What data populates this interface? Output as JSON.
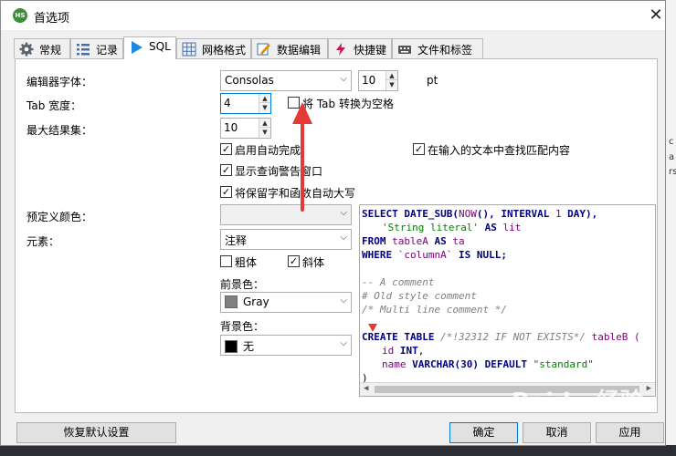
{
  "window": {
    "title": "首选项",
    "app_icon_text": "HS"
  },
  "tabs": [
    {
      "label": "常规",
      "icon": "gear-icon"
    },
    {
      "label": "记录",
      "icon": "list-icon"
    },
    {
      "label": "SQL",
      "icon": "play-icon"
    },
    {
      "label": "网格格式",
      "icon": "grid-icon"
    },
    {
      "label": "数据编辑",
      "icon": "edit-icon"
    },
    {
      "label": "快捷键",
      "icon": "lightning-icon"
    },
    {
      "label": "文件和标签",
      "icon": "keyboard-icon"
    }
  ],
  "active_tab": "SQL",
  "sql": {
    "editor_font_label": "编辑器字体：",
    "editor_font_value": "Consolas",
    "font_size_value": "10",
    "font_size_unit": "pt",
    "tab_width_label": "Tab 宽度：",
    "tab_width_value": "4",
    "tabs_to_spaces_label": "将 Tab 转换为空格",
    "tabs_to_spaces_checked": false,
    "max_results_label": "最大结果集：",
    "max_results_value": "10",
    "autocomplete_label": "启用自动完成",
    "autocomplete_checked": true,
    "query_warning_label": "显示查询警告窗口",
    "query_warning_checked": true,
    "uppercase_label": "将保留字和函数自动大写",
    "uppercase_checked": true,
    "find_matching_label": "在输入的文本中查找匹配内容",
    "find_matching_checked": true,
    "predefined_colors_label": "预定义颜色：",
    "predefined_colors_value": "",
    "element_label": "元素：",
    "element_value": "注释",
    "bold_label": "粗体",
    "bold_checked": false,
    "italic_label": "斜体",
    "italic_checked": true,
    "foreground_label": "前景色：",
    "foreground_value": "Gray",
    "foreground_color": "#808080",
    "background_label": "背景色：",
    "background_value": "无",
    "background_color": "#000000"
  },
  "preview": {
    "l1a": "SELECT DATE_SUB(",
    "l1b": "NOW",
    "l1c": "(), INTERVAL ",
    "l1d": "1",
    "l1e": " DAY),",
    "l2a": "'String literal'",
    "l2b": " AS ",
    "l2c": "lit",
    "l3a": "FROM ",
    "l3b": "tableA",
    "l3c": " AS ",
    "l3d": "ta",
    "l4a": "WHERE ",
    "l4b": "`columnA`",
    "l4c": " IS NULL;",
    "c1": "-- A comment",
    "c2": "# Old style comment",
    "c3": "/* Multi line comment */",
    "l5a": "CREATE TABLE ",
    "l5b": "/*!32312 IF NOT EXISTS*/",
    "l5c": " tableB (",
    "l6a": "id ",
    "l6b": "INT",
    "l6c": ",",
    "l7a": "name ",
    "l7b": "VARCHAR",
    "l7c": "(30) ",
    "l7d": "DEFAULT",
    "l7e": " \"standard\"",
    "l8": ")"
  },
  "buttons": {
    "restore_defaults": "恢复默认设置",
    "ok": "确定",
    "cancel": "取消",
    "apply": "应用"
  },
  "watermark": "Baidu 经验",
  "colors": {
    "accent": "#0078d7",
    "annotation_arrow": "#e53935"
  }
}
